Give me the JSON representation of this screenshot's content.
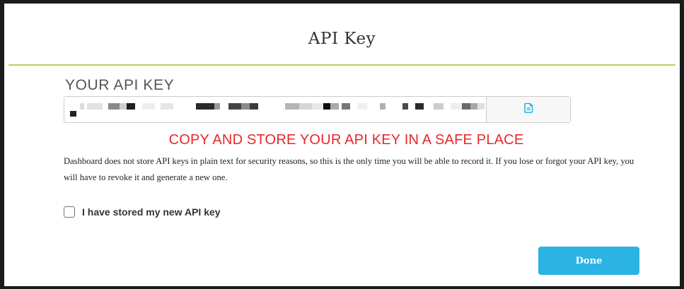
{
  "dialog": {
    "title": "API Key"
  },
  "api_key": {
    "label": "YOUR API KEY",
    "value": ""
  },
  "copy_button": {
    "icon": "copy-icon",
    "color": "#2ab3e3"
  },
  "warning": {
    "text": "COPY AND STORE YOUR API KEY IN A SAFE PLACE",
    "color": "#e8262b"
  },
  "explanation": {
    "text": "Dashboard does not store API keys in plain text for security reasons, so this is the only time you will be able to record it. If you lose or forgot your API key, you will have to revoke it and generate a new one."
  },
  "confirm_checkbox": {
    "label": "I have stored my new API key",
    "checked": false
  },
  "done_button": {
    "label": "Done",
    "color": "#2ab3e3"
  },
  "colors": {
    "header_rule": "#b6cf57",
    "frame": "#1b1b1b"
  }
}
